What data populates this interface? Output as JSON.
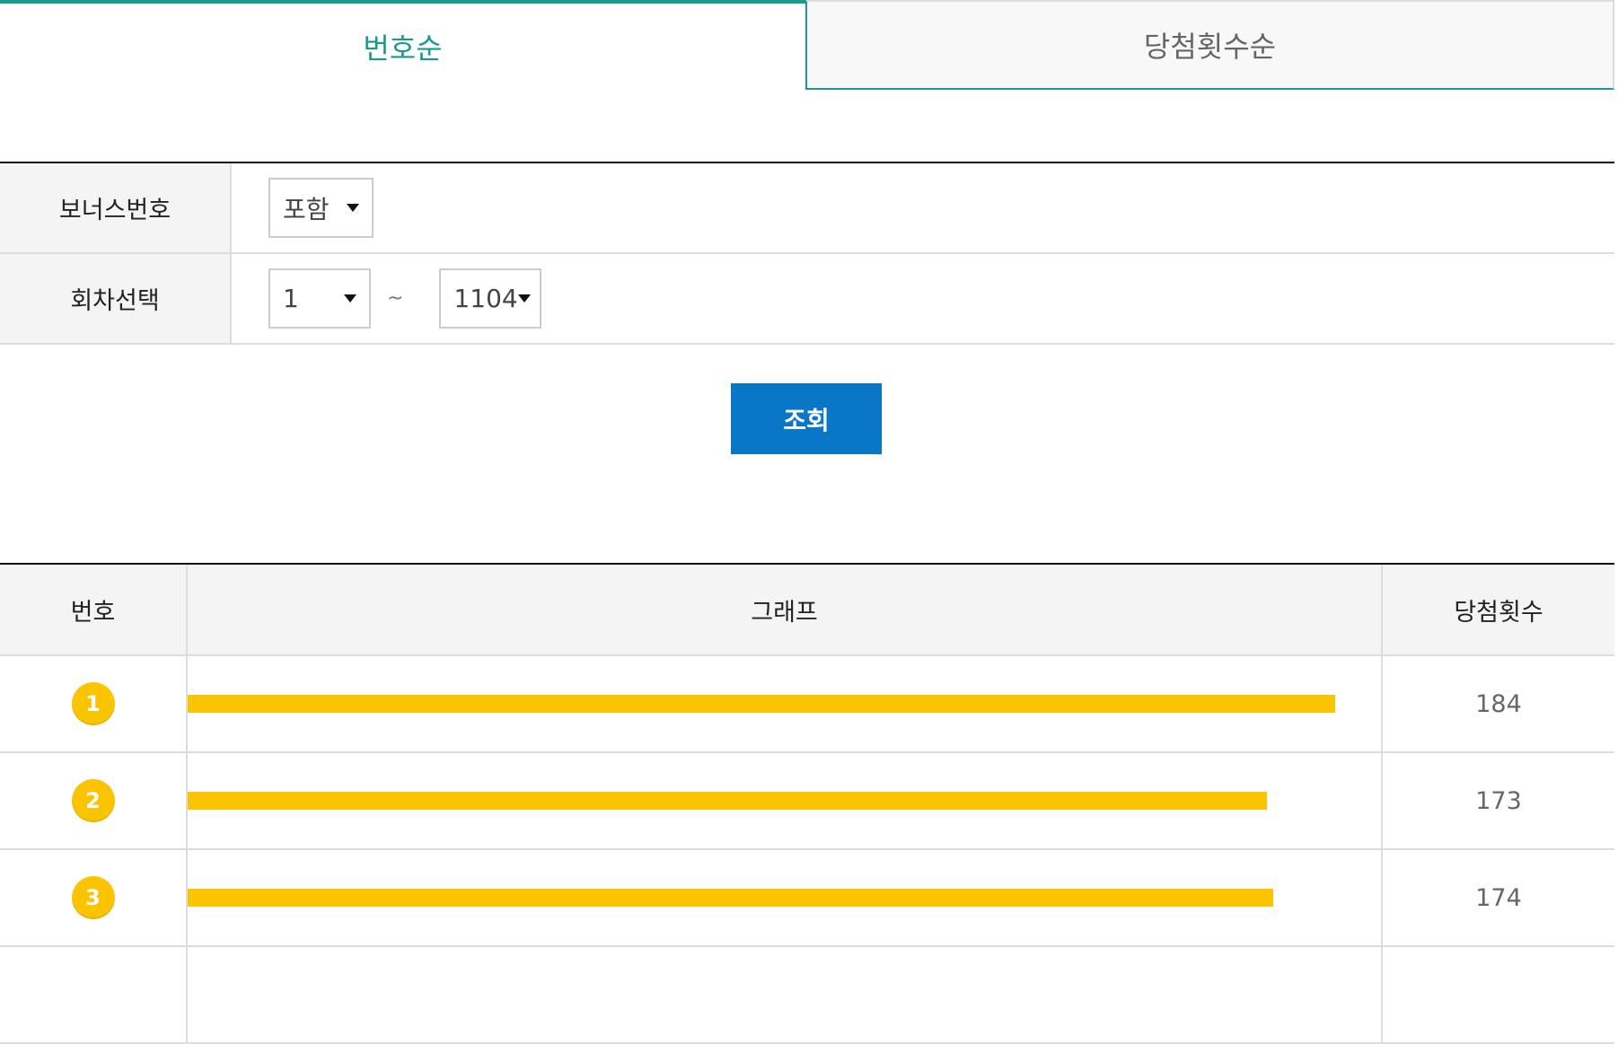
{
  "tabs": [
    {
      "label": "번호순",
      "active": true
    },
    {
      "label": "당첨횟수순",
      "active": false
    }
  ],
  "filters": {
    "bonus": {
      "label": "보너스번호",
      "value": "포함"
    },
    "round": {
      "label": "회차선택",
      "from": "1",
      "separator": "~",
      "to": "1104"
    }
  },
  "search_button": "조회",
  "results": {
    "headers": {
      "number": "번호",
      "graph": "그래프",
      "count": "당첨횟수"
    },
    "rows": [
      {
        "number": "1",
        "count": "184"
      },
      {
        "number": "2",
        "count": "173"
      },
      {
        "number": "3",
        "count": "174"
      }
    ]
  },
  "colors": {
    "accent": "#1a9a8c",
    "button": "#0a77c6",
    "ball": "#fbc400"
  },
  "chart_data": {
    "type": "bar",
    "categories": [
      "1",
      "2",
      "3"
    ],
    "values": [
      184,
      173,
      174
    ],
    "xlabel": "번호",
    "ylabel": "당첨횟수",
    "max_value": 184
  }
}
